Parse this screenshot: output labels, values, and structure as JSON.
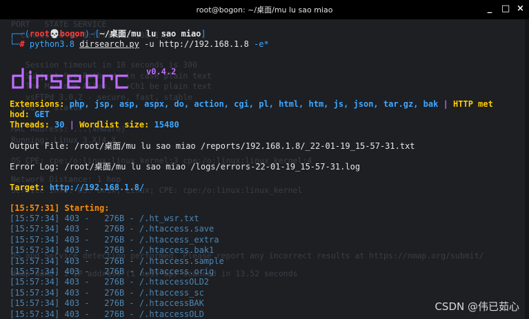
{
  "window": {
    "title": "root@bogon: ~/桌面/mu lu sao miao",
    "minimize_glyph": "_",
    "maximize_glyph": "□",
    "close_glyph": "×"
  },
  "ghost_lines": [
    "PORT   STATE SERVICE",
    "  Connected to 1:ffff:192.168.1.8",
    "   Session timeout in 10 seconds is 300",
    "   Subject Sys.Path: /  in case plain text",
    "   The Maximum Allow. : +Ch1 be plain text",
    "   vsFTPd 3.0.2 - secure, fast, stable",
    "| End of status",
    "MAC Address: ...(VMware)",
    "Running: Linux 3.X|4.X",
    "OS CPE: cpe:/o:linux:linux_kernel:3 cpe:/o:linux:linux_kernel:4",
    "Network Distance: 1 hop",
    "Service Info: OS: Unix, Linux; CPE: cpe:/o:linux:linux_kernel",
    "OS and Service detection performed. Please report any incorrect results at https://nmap.org/submit/",
    "Nmap done: 1 IP address (1 host up) scanned in 13.52 seconds"
  ],
  "prompt": {
    "open_bracket": "┌──(",
    "user": "root",
    "skull": "💀",
    "host": "bogon",
    "mid": ")-[",
    "path": "~/桌面/mu lu sao miao",
    "close_bracket": "]",
    "corner": "└─",
    "hash": "#",
    "cmd_python": "python3.8",
    "cmd_script": "dirsearch.py",
    "cmd_args": "-u http://192.168.1.8",
    "cmd_flag": "-e*"
  },
  "banner": {
    "version": "v0.4.2"
  },
  "config": {
    "ext_label": "Extensions:",
    "ext_values": "php, jsp, asp, aspx, do, action, cgi, pl, html, htm, js, json, tar.gz, bak",
    "sep": "|",
    "http_label_a": "HTTP met",
    "http_label_b": "hod:",
    "http_value": "GET",
    "threads_label": "Threads:",
    "threads_value": "30",
    "wordlist_label": "Wordlist size:",
    "wordlist_value": "15480"
  },
  "output_file": "Output File: /root/桌面/mu lu sao miao /reports/192.168.1.8/_22-01-19_15-57-31.txt",
  "error_log": "Error Log: /root/桌面/mu lu sao miao /logs/errors-22-01-19_15-57-31.log",
  "target": {
    "label": "Target:",
    "url": "http://192.168.1.8/"
  },
  "starting": "[15:57:31] Starting:",
  "results": [
    {
      "time": "[15:57:34]",
      "code": "403",
      "size": "276B",
      "path": "/.ht_wsr.txt"
    },
    {
      "time": "[15:57:34]",
      "code": "403",
      "size": "276B",
      "path": "/.htaccess.save"
    },
    {
      "time": "[15:57:34]",
      "code": "403",
      "size": "276B",
      "path": "/.htaccess_extra"
    },
    {
      "time": "[15:57:34]",
      "code": "403",
      "size": "276B",
      "path": "/.htaccess.bak1"
    },
    {
      "time": "[15:57:34]",
      "code": "403",
      "size": "276B",
      "path": "/.htaccess.sample"
    },
    {
      "time": "[15:57:34]",
      "code": "403",
      "size": "276B",
      "path": "/.htaccess.orig"
    },
    {
      "time": "[15:57:34]",
      "code": "403",
      "size": "276B",
      "path": "/.htaccessOLD2"
    },
    {
      "time": "[15:57:34]",
      "code": "403",
      "size": "276B",
      "path": "/.htaccess_sc"
    },
    {
      "time": "[15:57:34]",
      "code": "403",
      "size": "276B",
      "path": "/.htaccessBAK"
    },
    {
      "time": "[15:57:34]",
      "code": "403",
      "size": "276B",
      "path": "/.htaccessOLD"
    }
  ],
  "watermark": "CSDN @伟已茹心",
  "colors": {
    "background": "#1d1f23",
    "prompt_blue": "#2f9bff",
    "prompt_red": "#ff3c3c",
    "label_yellow": "#ffcc00",
    "banner_purple": "#c06cff",
    "starting_orange": "#ff8c00",
    "result_steel": "#4d86b3"
  }
}
